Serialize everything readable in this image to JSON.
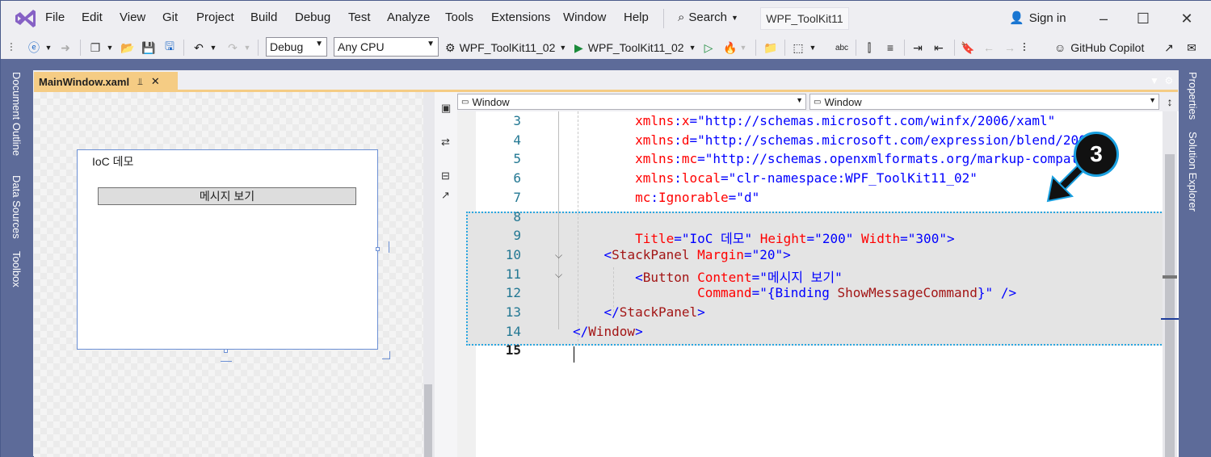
{
  "menubar": {
    "items": [
      "File",
      "Edit",
      "View",
      "Git",
      "Project",
      "Build",
      "Debug",
      "Test",
      "Analyze",
      "Tools",
      "Extensions",
      "Window",
      "Help"
    ],
    "search_label": "Search",
    "solution_name": "WPF_ToolKit11",
    "signin_label": "Sign in"
  },
  "toolbar": {
    "config_value": "Debug",
    "platform_value": "Any CPU",
    "startup_project": "WPF_ToolKit11_02",
    "run_target": "WPF_ToolKit11_02",
    "copilot_label": "GitHub Copilot"
  },
  "left_rail": [
    "Document Outline",
    "Data Sources",
    "Toolbox"
  ],
  "right_rail": [
    "Properties",
    "Solution Explorer"
  ],
  "document_tab": {
    "title": "MainWindow.xaml"
  },
  "designer": {
    "window_title": "IoC 데모",
    "button_label": "메시지 보기"
  },
  "navbar": {
    "left_value": "Window",
    "right_value": "Window"
  },
  "badge": "3",
  "code_lines": [
    {
      "n": "3",
      "parts": [
        {
          "t": "        "
        },
        {
          "t": "xmlns",
          "c": "at"
        },
        {
          "t": ":",
          "c": "vl"
        },
        {
          "t": "x",
          "c": "at"
        },
        {
          "t": "=\"http://schemas.microsoft.com/winfx/2006/xaml\"",
          "c": "vl"
        }
      ]
    },
    {
      "n": "4",
      "parts": [
        {
          "t": "        "
        },
        {
          "t": "xmlns",
          "c": "at"
        },
        {
          "t": ":",
          "c": "vl"
        },
        {
          "t": "d",
          "c": "at"
        },
        {
          "t": "=\"http://schemas.microsoft.com/expression/blend/2008\"",
          "c": "vl"
        }
      ]
    },
    {
      "n": "5",
      "parts": [
        {
          "t": "        "
        },
        {
          "t": "xmlns",
          "c": "at"
        },
        {
          "t": ":",
          "c": "vl"
        },
        {
          "t": "mc",
          "c": "at"
        },
        {
          "t": "=\"http://schemas.openxmlformats.org/markup-compatibi",
          "c": "vl"
        }
      ]
    },
    {
      "n": "6",
      "parts": [
        {
          "t": "        "
        },
        {
          "t": "xmlns",
          "c": "at"
        },
        {
          "t": ":",
          "c": "vl"
        },
        {
          "t": "local",
          "c": "at"
        },
        {
          "t": "=\"clr-namespace:WPF_ToolKit11_02\"",
          "c": "vl"
        }
      ]
    },
    {
      "n": "7",
      "parts": [
        {
          "t": "        "
        },
        {
          "t": "mc",
          "c": "at"
        },
        {
          "t": ":",
          "c": "vl"
        },
        {
          "t": "Ignorable",
          "c": "at"
        },
        {
          "t": "=\"d\"",
          "c": "vl"
        }
      ]
    },
    {
      "n": "8",
      "parts": [
        {
          "t": ""
        }
      ]
    },
    {
      "n": "9",
      "parts": [
        {
          "t": "        "
        },
        {
          "t": "Title",
          "c": "at"
        },
        {
          "t": "=\"IoC 데모\" ",
          "c": "vl"
        },
        {
          "t": "Height",
          "c": "at"
        },
        {
          "t": "=\"200\" ",
          "c": "vl"
        },
        {
          "t": "Width",
          "c": "at"
        },
        {
          "t": "=\"300\">",
          "c": "vl"
        }
      ]
    },
    {
      "n": "10",
      "parts": [
        {
          "t": "    "
        },
        {
          "t": "<",
          "c": "vl"
        },
        {
          "t": "StackPanel",
          "c": "el"
        },
        {
          "t": " "
        },
        {
          "t": "Margin",
          "c": "at"
        },
        {
          "t": "=\"20\">",
          "c": "vl"
        }
      ]
    },
    {
      "n": "11",
      "parts": [
        {
          "t": "        "
        },
        {
          "t": "<",
          "c": "vl"
        },
        {
          "t": "Button",
          "c": "el"
        },
        {
          "t": " "
        },
        {
          "t": "Content",
          "c": "at"
        },
        {
          "t": "=\"메시지 보기\"",
          "c": "vl"
        }
      ]
    },
    {
      "n": "12",
      "parts": [
        {
          "t": "                "
        },
        {
          "t": "Command",
          "c": "at"
        },
        {
          "t": "=\"{Binding ",
          "c": "vl"
        },
        {
          "t": "ShowMessageCommand",
          "c": "el"
        },
        {
          "t": "}\" />",
          "c": "vl"
        }
      ]
    },
    {
      "n": "13",
      "parts": [
        {
          "t": "    "
        },
        {
          "t": "</",
          "c": "vl"
        },
        {
          "t": "StackPanel",
          "c": "el"
        },
        {
          "t": ">",
          "c": "vl"
        }
      ]
    },
    {
      "n": "14",
      "parts": [
        {
          "t": ""
        },
        {
          "t": "</",
          "c": "vl"
        },
        {
          "t": "Window",
          "c": "el"
        },
        {
          "t": ">",
          "c": "vl"
        }
      ]
    },
    {
      "n": "15",
      "parts": [
        {
          "t": ""
        }
      ]
    }
  ]
}
